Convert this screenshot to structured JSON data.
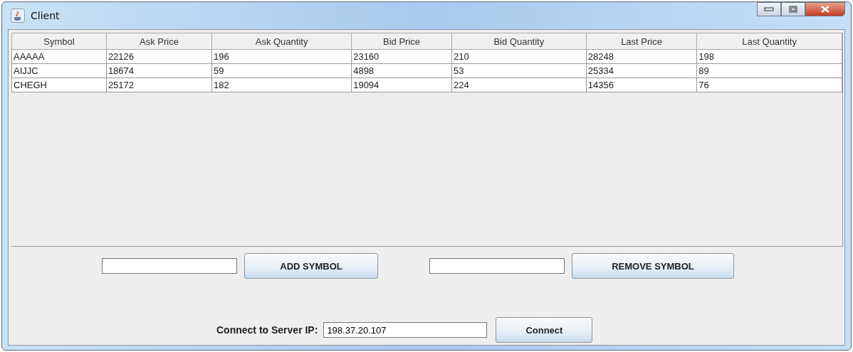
{
  "window": {
    "title": "Client"
  },
  "table": {
    "columns": [
      "Symbol",
      "Ask Price",
      "Ask Quantity",
      "Bid Price",
      "Bid Quantity",
      "Last Price",
      "Last Quantity"
    ],
    "rows": [
      [
        "AAAAA",
        "22126",
        "196",
        "23160",
        "210",
        "28248",
        "198"
      ],
      [
        "AIJJC",
        "18674",
        "59",
        "4898",
        "53",
        "25334",
        "89"
      ],
      [
        "CHEGH",
        "25172",
        "182",
        "19094",
        "224",
        "14356",
        "76"
      ]
    ]
  },
  "add_symbol": {
    "button": "ADD SYMBOL"
  },
  "remove_symbol": {
    "button": "REMOVE SYMBOL"
  },
  "connect": {
    "label": "Connect to Server IP:",
    "value": "198.37.20.107",
    "button": "Connect"
  }
}
